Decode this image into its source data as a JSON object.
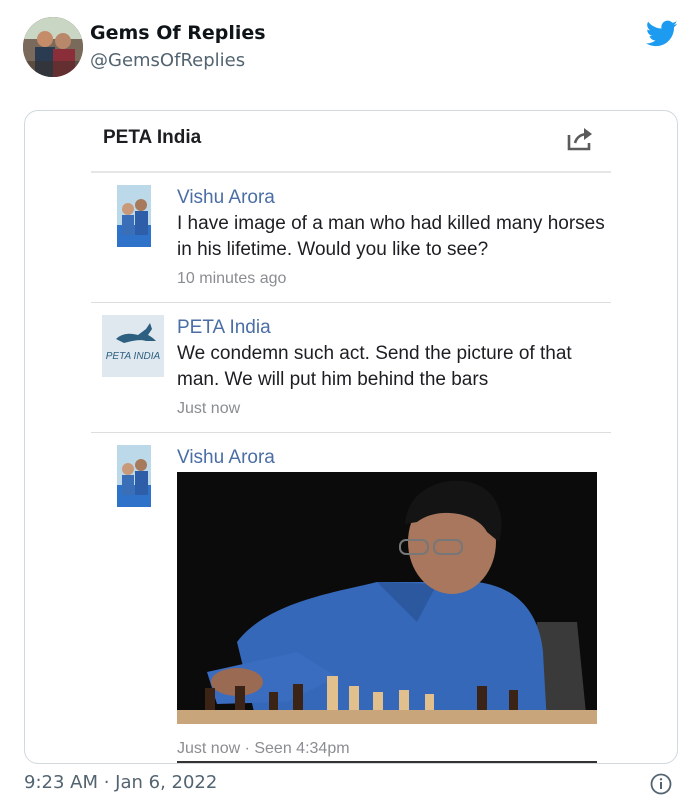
{
  "tweet": {
    "author_name": "Gems Of Replies",
    "author_handle": "@GemsOfReplies",
    "timestamp": "9:23 AM · Jan 6, 2022",
    "colors": {
      "brand": "#1d9bf0",
      "text": "#0f1419",
      "muted": "#536471",
      "border": "#cfd9de"
    }
  },
  "screenshot": {
    "header_title": "PETA India",
    "messages": [
      {
        "sender": "Vishu Arora",
        "text": "I have image of a man who had killed many horses in his lifetime. Would you like to see?",
        "meta": "10 minutes ago"
      },
      {
        "sender": "PETA India",
        "logo_text": "PETA INDIA",
        "text": "We condemn such act. Send the picture of that man. We will put him behind the bars",
        "meta": "Just now"
      },
      {
        "sender": "Vishu Arora",
        "meta": "Just now · Seen 4:34pm"
      }
    ],
    "colors": {
      "sender": "#4a6ea5",
      "meta": "#8a8d91",
      "logo_bg": "#dfe8ee",
      "logo_accent": "#2d5f80"
    }
  },
  "icons": {
    "brand": "twitter-bird-icon",
    "share": "share-icon",
    "info": "info-icon"
  }
}
